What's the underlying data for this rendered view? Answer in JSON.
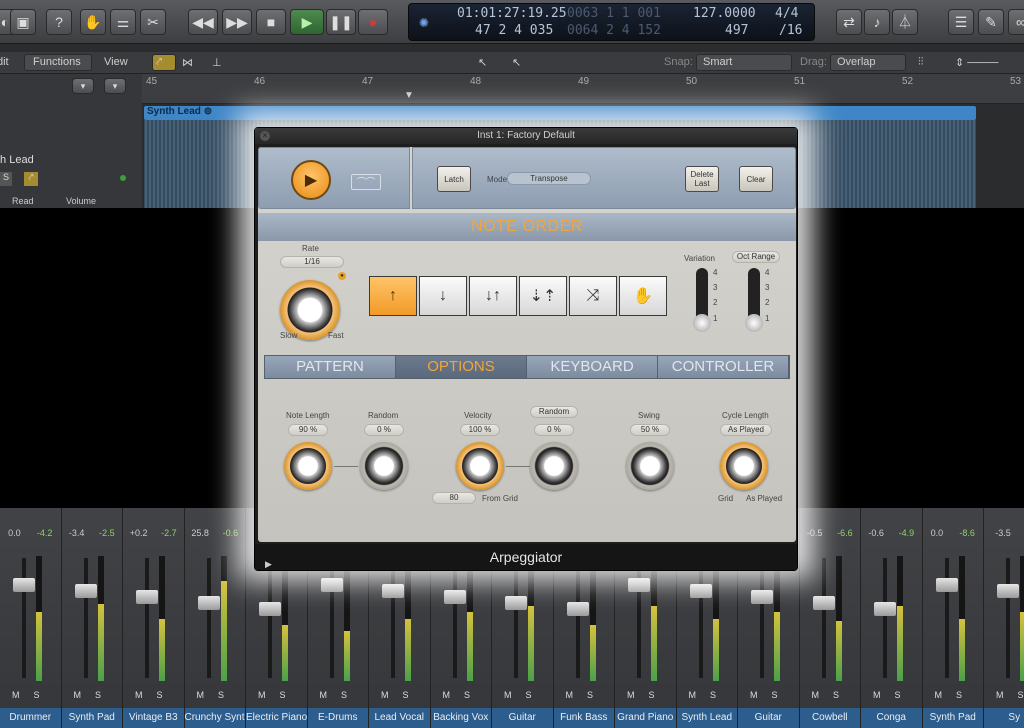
{
  "toolbar": {
    "lcd": {
      "position": "01:01:27:19.25",
      "position_dim": "0063  1  1  001",
      "bars": "47  2  4  035",
      "bars_dim": "0064  2  4  152",
      "tempo": "127.0000",
      "bpm": "497",
      "signature": "4/4",
      "division": "/16"
    }
  },
  "arrange": {
    "menus": [
      "dit",
      "Functions",
      "View"
    ],
    "snap_label": "Snap:",
    "snap_value": "Smart",
    "drag_label": "Drag:",
    "drag_value": "Overlap",
    "ruler": [
      "45",
      "46",
      "47",
      "48",
      "49",
      "50",
      "51",
      "52",
      "53"
    ],
    "region_name": "Synth Lead",
    "track_header_name": "th Lead",
    "read_label": "Read",
    "volume_label": "Volume"
  },
  "mixer": {
    "channels": [
      {
        "name": "Drummer",
        "vol": "0.0",
        "peak": "-4.2"
      },
      {
        "name": "Synth Pad",
        "vol": "-3.4",
        "peak": "-2.5"
      },
      {
        "name": "Vintage B3",
        "vol": "+0.2",
        "peak": "-2.7"
      },
      {
        "name": "Crunchy Synth",
        "vol": "25.8",
        "peak": "-0.6"
      },
      {
        "name": "Electric Piano",
        "vol": "",
        "peak": ""
      },
      {
        "name": "E-Drums",
        "vol": "",
        "peak": ""
      },
      {
        "name": "Lead Vocal",
        "vol": "",
        "peak": ""
      },
      {
        "name": "Backing Vox",
        "vol": "",
        "peak": ""
      },
      {
        "name": "Guitar",
        "vol": "",
        "peak": ""
      },
      {
        "name": "Funk Bass",
        "vol": "",
        "peak": ""
      },
      {
        "name": "Grand Piano",
        "vol": "",
        "peak": ""
      },
      {
        "name": "Synth Lead",
        "vol": "",
        "peak": ""
      },
      {
        "name": "Guitar",
        "vol": "",
        "peak": ""
      },
      {
        "name": "Cowbell",
        "vol": "-0.5",
        "peak": "-6.6"
      },
      {
        "name": "Conga",
        "vol": "-0.6",
        "peak": "-4.9"
      },
      {
        "name": "Synth Pad",
        "vol": "0.0",
        "peak": "-8.6"
      },
      {
        "name": "Sy",
        "vol": "-3.5",
        "peak": ""
      }
    ],
    "mute_label": "M",
    "solo_label": "S"
  },
  "arpeggiator": {
    "window_title": "Inst 1: Factory Default",
    "footer_title": "Arpeggiator",
    "latch_label": "Latch",
    "mode_label": "Mode",
    "mode_value": "Transpose",
    "delete_last_label": "Delete Last",
    "clear_label": "Clear",
    "note_order_title": "NOTE ORDER",
    "rate_label": "Rate",
    "rate_value": "1/16",
    "slow_label": "Slow",
    "fast_label": "Fast",
    "variation_label": "Variation",
    "oct_range_label": "Oct Range",
    "variation_value": 1,
    "oct_range_value": 1,
    "ticks": [
      "4",
      "3",
      "2",
      "1"
    ],
    "order_buttons": [
      "up",
      "down",
      "up-down",
      "outside-in",
      "random",
      "as-played"
    ],
    "active_order": "up",
    "tabs": [
      "PATTERN",
      "OPTIONS",
      "KEYBOARD",
      "CONTROLLER"
    ],
    "active_tab": "OPTIONS",
    "options": {
      "note_length_label": "Note Length",
      "note_length_value": "90 %",
      "random1_label": "Random",
      "random1_value": "0 %",
      "velocity_label": "Velocity",
      "velocity_value": "100 %",
      "random2_label": "Random",
      "random2_value": "0 %",
      "swing_label": "Swing",
      "swing_value": "50 %",
      "cycle_length_label": "Cycle Length",
      "cycle_length_value": "As Played",
      "velocity_grid_value": "80",
      "from_grid_label": "From Grid",
      "grid_label": "Grid",
      "as_played_label": "As Played"
    }
  }
}
